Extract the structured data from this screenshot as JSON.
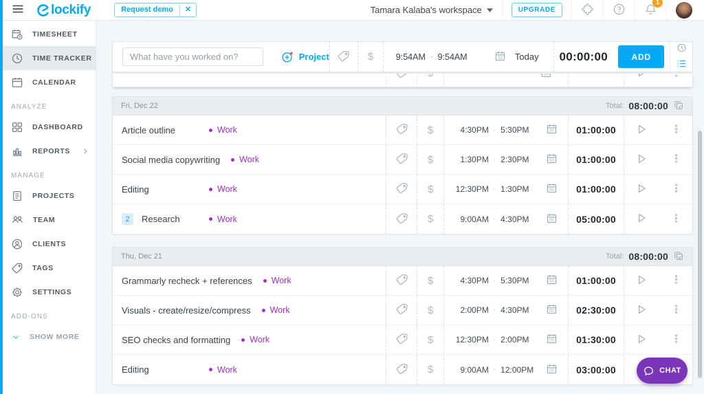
{
  "topbar": {
    "logo_text": "lockify",
    "request_demo_label": "Request demo",
    "request_demo_close": "✕",
    "workspace_label": "Tamara Kalaba's workspace",
    "upgrade_label": "UPGRADE",
    "notification_count": "1"
  },
  "sidebar": {
    "items": [
      {
        "type": "item",
        "label": "TIMESHEET",
        "icon": "timesheet"
      },
      {
        "type": "item",
        "label": "TIME TRACKER",
        "icon": "time-tracker",
        "active": true
      },
      {
        "type": "item",
        "label": "CALENDAR",
        "icon": "calendar"
      },
      {
        "type": "section",
        "label": "ANALYZE"
      },
      {
        "type": "item",
        "label": "DASHBOARD",
        "icon": "dashboard"
      },
      {
        "type": "item",
        "label": "REPORTS",
        "icon": "reports",
        "chevron": "right"
      },
      {
        "type": "section",
        "label": "MANAGE"
      },
      {
        "type": "item",
        "label": "PROJECTS",
        "icon": "projects"
      },
      {
        "type": "item",
        "label": "TEAM",
        "icon": "team"
      },
      {
        "type": "item",
        "label": "CLIENTS",
        "icon": "clients"
      },
      {
        "type": "item",
        "label": "TAGS",
        "icon": "tags"
      },
      {
        "type": "item",
        "label": "SETTINGS",
        "icon": "settings"
      },
      {
        "type": "section",
        "label": "ADD-ONS"
      },
      {
        "type": "item",
        "label": "SHOW MORE",
        "icon": "chevron-down",
        "muted": true
      }
    ]
  },
  "tracker": {
    "placeholder": "What have you worked on?",
    "project_label": "Project",
    "start_time": "9:54AM",
    "time_separator": "-",
    "end_time": "9:54AM",
    "date_label": "Today",
    "duration": "00:00:00",
    "add_label": "ADD"
  },
  "entry_groups": [
    {
      "date": "Fri, Dec 22",
      "total_label": "Total:",
      "total": "08:00:00",
      "entries": [
        {
          "description": "Article outline",
          "project": "Work",
          "start": "4:30PM",
          "end": "5:30PM",
          "duration": "01:00:00"
        },
        {
          "description": "Social media copywriting",
          "project": "Work",
          "start": "1:30PM",
          "end": "2:30PM",
          "duration": "01:00:00"
        },
        {
          "description": "Editing",
          "project": "Work",
          "start": "12:30PM",
          "end": "1:30PM",
          "duration": "01:00:00"
        },
        {
          "description": "Research",
          "project": "Work",
          "badge": "2",
          "start": "9:00AM",
          "end": "4:30PM",
          "duration": "05:00:00"
        }
      ]
    },
    {
      "date": "Thu, Dec 21",
      "total_label": "Total:",
      "total": "08:00:00",
      "entries": [
        {
          "description": "Grammarly recheck + references",
          "project": "Work",
          "start": "4:30PM",
          "end": "5:30PM",
          "duration": "01:00:00"
        },
        {
          "description": "Visuals - create/resize/compress",
          "project": "Work",
          "start": "2:00PM",
          "end": "4:30PM",
          "duration": "02:30:00"
        },
        {
          "description": "SEO checks and formatting",
          "project": "Work",
          "start": "12:30PM",
          "end": "2:00PM",
          "duration": "01:30:00"
        },
        {
          "description": "Editing",
          "project": "Work",
          "start": "9:00AM",
          "end": "12:00PM",
          "duration": "03:00:00"
        }
      ]
    }
  ],
  "chat": {
    "label": "CHAT"
  },
  "colors": {
    "brand_blue": "#03A9F4",
    "project_work_purple": "#A12FC7",
    "chat_purple": "#7B35B8",
    "notification_orange": "#F9A11B",
    "page_background": "#F2F6F8"
  }
}
